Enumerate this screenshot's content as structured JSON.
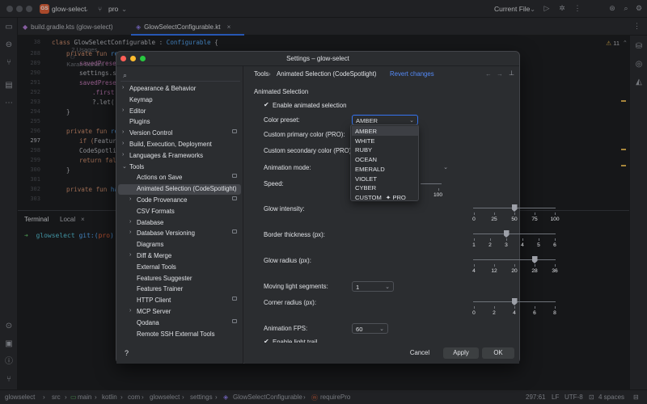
{
  "titlebar": {
    "project_badge": "GS",
    "project_name": "glow-select",
    "branch": "pro",
    "run_config": "Current File"
  },
  "tabs": [
    {
      "label": "build.gradle.kts (glow-select)"
    },
    {
      "label": "GlowSelectConfigurable.kt"
    }
  ],
  "editor": {
    "line_numbers": [
      "38",
      "288",
      "289",
      "290",
      "291",
      "292",
      "293",
      "294",
      "295",
      "296",
      "297",
      "298",
      "299",
      "300",
      "301",
      "302",
      "303"
    ],
    "usages": "2 Usages",
    "author": "Karan Sahani",
    "warnings": "11",
    "lines": {
      "l38": [
        "class ",
        "GlowSelectConfigurable",
        " : ",
        "Configurable",
        " {"
      ],
      "l288": [
        "private fun ",
        "ref"
      ],
      "l289": "savedPrese",
      "l290": "settings.s",
      "l291": "savedPrese",
      "l292": ".first",
      "l293": "?.let(",
      "l294": "}",
      "l296": [
        "private fun ",
        "re"
      ],
      "l297": [
        "if (",
        "Featur"
      ],
      "l298": "CodeSpotli",
      "l299": [
        "return ",
        "fal"
      ],
      "l300": "}",
      "l302": [
        "private fun ",
        "ha"
      ]
    }
  },
  "terminal": {
    "tabs": [
      "Terminal",
      "Local"
    ],
    "prompt_arrow": "➜",
    "prompt_dir": "glowselect",
    "prompt_git": "git:(",
    "prompt_branch": "pro",
    "prompt_close": ")"
  },
  "statusbar": {
    "crumbs": [
      "glowselect",
      "src",
      "main",
      "kotlin",
      "com",
      "glowselect",
      "settings",
      "GlowSelectConfigurable",
      "requirePro"
    ],
    "position": "297:61",
    "line_sep": "LF",
    "encoding": "UTF-8",
    "indent": "4 spaces"
  },
  "dialog": {
    "title": "Settings – glow-select",
    "search_placeholder": "",
    "breadcrumb_parent": "Tools",
    "breadcrumb_sep": "›",
    "breadcrumb_current": "Animated Selection (CodeSpotlight)",
    "revert": "Revert changes",
    "help": "?",
    "tree": [
      {
        "label": "Appearance & Behavior",
        "arrow": "›",
        "indent": 0
      },
      {
        "label": "Keymap",
        "arrow": "",
        "indent": 0
      },
      {
        "label": "Editor",
        "arrow": "›",
        "indent": 0
      },
      {
        "label": "Plugins",
        "arrow": "",
        "indent": 0
      },
      {
        "label": "Version Control",
        "arrow": "›",
        "indent": 0,
        "mark": true
      },
      {
        "label": "Build, Execution, Deployment",
        "arrow": "›",
        "indent": 0
      },
      {
        "label": "Languages & Frameworks",
        "arrow": "›",
        "indent": 0
      },
      {
        "label": "Tools",
        "arrow": "⌄",
        "indent": 0
      },
      {
        "label": "Actions on Save",
        "arrow": "",
        "indent": 1,
        "mark": true
      },
      {
        "label": "Animated Selection (CodeSpotlight)",
        "arrow": "",
        "indent": 1,
        "selected": true
      },
      {
        "label": "Code Provenance",
        "arrow": "›",
        "indent": 1,
        "mark": true
      },
      {
        "label": "CSV Formats",
        "arrow": "",
        "indent": 1
      },
      {
        "label": "Database",
        "arrow": "›",
        "indent": 1
      },
      {
        "label": "Database Versioning",
        "arrow": "›",
        "indent": 1,
        "mark": true
      },
      {
        "label": "Diagrams",
        "arrow": "",
        "indent": 1
      },
      {
        "label": "Diff & Merge",
        "arrow": "›",
        "indent": 1
      },
      {
        "label": "External Tools",
        "arrow": "",
        "indent": 1
      },
      {
        "label": "Features Suggester",
        "arrow": "",
        "indent": 1
      },
      {
        "label": "Features Trainer",
        "arrow": "",
        "indent": 1
      },
      {
        "label": "HTTP Client",
        "arrow": "",
        "indent": 1,
        "mark": true
      },
      {
        "label": "MCP Server",
        "arrow": "›",
        "indent": 1
      },
      {
        "label": "Qodana",
        "arrow": "",
        "indent": 1,
        "mark": true
      },
      {
        "label": "Remote SSH External Tools",
        "arrow": "",
        "indent": 1
      }
    ],
    "section_title": "Animated Selection",
    "enable_label": "Enable animated selection",
    "enable_checked": true,
    "color_preset_label": "Color preset:",
    "color_preset_value": "AMBER",
    "custom_primary_label": "Custom primary color (PRO):",
    "custom_secondary_label": "Custom secondary color (PRO):",
    "animation_mode_label": "Animation mode:",
    "speed_label": "Speed:",
    "speed_last_tick": "100",
    "glow_label": "Glow intensity:",
    "glow": {
      "ticks": [
        "0",
        "25",
        "50",
        "75",
        "100"
      ],
      "value": 50,
      "min": 0,
      "max": 100
    },
    "border_label": "Border thickness (px):",
    "border": {
      "ticks": [
        "1",
        "2",
        "3",
        "4",
        "5",
        "6"
      ],
      "value": 3,
      "min": 1,
      "max": 6
    },
    "radius_label": "Glow radius (px):",
    "radius": {
      "ticks": [
        "4",
        "12",
        "20",
        "28",
        "36"
      ],
      "value": 28,
      "min": 4,
      "max": 36
    },
    "moving_label": "Moving light segments:",
    "moving_value": "1",
    "corner_label": "Corner radius (px):",
    "corner": {
      "ticks": [
        "0",
        "2",
        "4",
        "6",
        "8"
      ],
      "value": 4,
      "min": 0,
      "max": 8
    },
    "fps_label": "Animation FPS:",
    "fps_value": "60",
    "trail_label": "Enable light trail",
    "trail_checked": true,
    "dropdown_options": [
      "AMBER",
      "WHITE",
      "RUBY",
      "OCEAN",
      "EMERALD",
      "VIOLET",
      "CYBER",
      "CUSTOM"
    ],
    "pro_badge": "✦ PRO",
    "cancel": "Cancel",
    "apply": "Apply",
    "ok": "OK"
  },
  "colors": {
    "accent": "#3574f0",
    "keyword": "#cf8e6d",
    "function": "#56a8f5",
    "badge": "#e0623a",
    "prompt_green": "#5fb865",
    "branch_red": "#e0623a"
  }
}
